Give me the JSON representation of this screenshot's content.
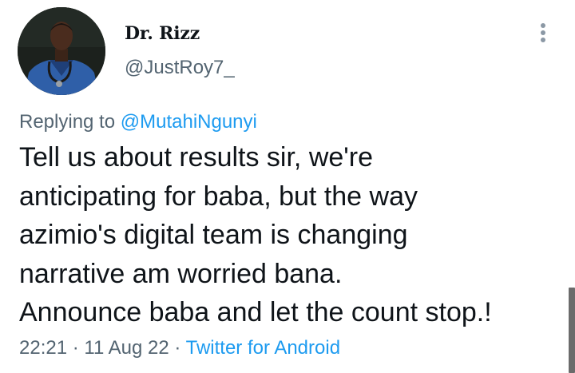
{
  "author": {
    "display_name": "Dr. Rizz",
    "handle": "@JustRoy7_"
  },
  "reply": {
    "prefix": "Replying to ",
    "mention": "@MutahiNgunyi"
  },
  "tweet": {
    "text": "Tell us about results sir, we're\nanticipating for baba, but the way\nazimio's digital team is changing\nnarrative am worried bana.\nAnnounce baba and let the count stop.!"
  },
  "meta": {
    "time": "22:21",
    "separator": " · ",
    "date": "11 Aug 22",
    "source": "Twitter for Android"
  },
  "icons": {
    "more": "more-vertical-icon",
    "avatar": "profile-photo"
  },
  "colors": {
    "text": "#0f1419",
    "secondary": "#536471",
    "link": "#1d9bf0"
  }
}
